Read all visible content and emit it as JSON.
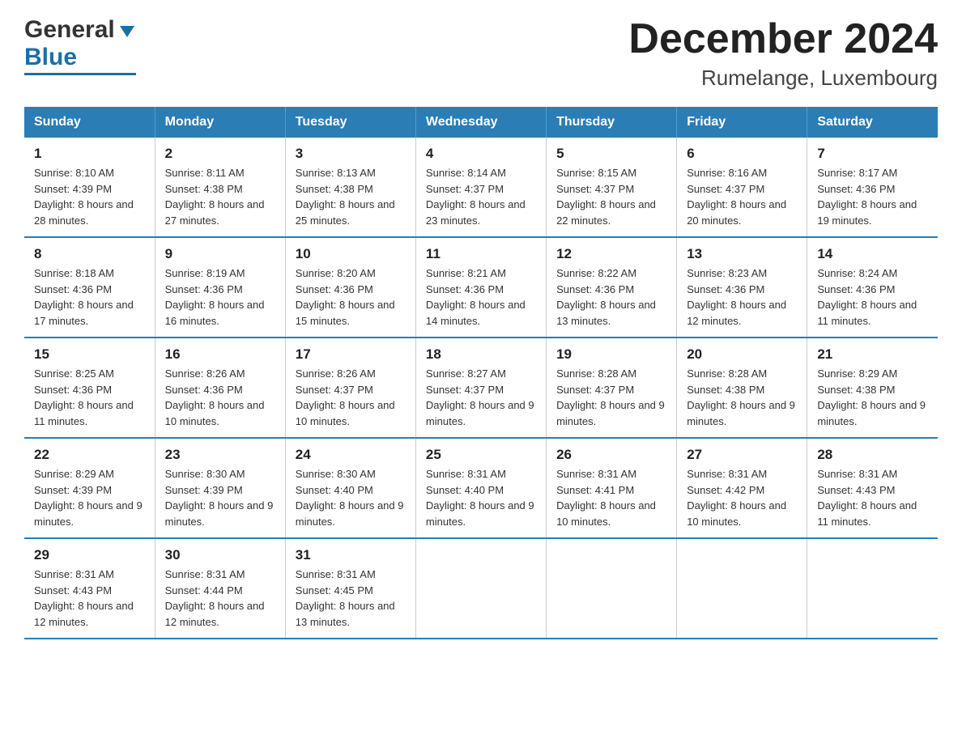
{
  "header": {
    "title": "December 2024",
    "subtitle": "Rumelange, Luxembourg",
    "logo_general": "General",
    "logo_blue": "Blue"
  },
  "weekdays": [
    "Sunday",
    "Monday",
    "Tuesday",
    "Wednesday",
    "Thursday",
    "Friday",
    "Saturday"
  ],
  "weeks": [
    [
      {
        "date": "1",
        "sunrise": "8:10 AM",
        "sunset": "4:39 PM",
        "daylight": "8 hours and 28 minutes."
      },
      {
        "date": "2",
        "sunrise": "8:11 AM",
        "sunset": "4:38 PM",
        "daylight": "8 hours and 27 minutes."
      },
      {
        "date": "3",
        "sunrise": "8:13 AM",
        "sunset": "4:38 PM",
        "daylight": "8 hours and 25 minutes."
      },
      {
        "date": "4",
        "sunrise": "8:14 AM",
        "sunset": "4:37 PM",
        "daylight": "8 hours and 23 minutes."
      },
      {
        "date": "5",
        "sunrise": "8:15 AM",
        "sunset": "4:37 PM",
        "daylight": "8 hours and 22 minutes."
      },
      {
        "date": "6",
        "sunrise": "8:16 AM",
        "sunset": "4:37 PM",
        "daylight": "8 hours and 20 minutes."
      },
      {
        "date": "7",
        "sunrise": "8:17 AM",
        "sunset": "4:36 PM",
        "daylight": "8 hours and 19 minutes."
      }
    ],
    [
      {
        "date": "8",
        "sunrise": "8:18 AM",
        "sunset": "4:36 PM",
        "daylight": "8 hours and 17 minutes."
      },
      {
        "date": "9",
        "sunrise": "8:19 AM",
        "sunset": "4:36 PM",
        "daylight": "8 hours and 16 minutes."
      },
      {
        "date": "10",
        "sunrise": "8:20 AM",
        "sunset": "4:36 PM",
        "daylight": "8 hours and 15 minutes."
      },
      {
        "date": "11",
        "sunrise": "8:21 AM",
        "sunset": "4:36 PM",
        "daylight": "8 hours and 14 minutes."
      },
      {
        "date": "12",
        "sunrise": "8:22 AM",
        "sunset": "4:36 PM",
        "daylight": "8 hours and 13 minutes."
      },
      {
        "date": "13",
        "sunrise": "8:23 AM",
        "sunset": "4:36 PM",
        "daylight": "8 hours and 12 minutes."
      },
      {
        "date": "14",
        "sunrise": "8:24 AM",
        "sunset": "4:36 PM",
        "daylight": "8 hours and 11 minutes."
      }
    ],
    [
      {
        "date": "15",
        "sunrise": "8:25 AM",
        "sunset": "4:36 PM",
        "daylight": "8 hours and 11 minutes."
      },
      {
        "date": "16",
        "sunrise": "8:26 AM",
        "sunset": "4:36 PM",
        "daylight": "8 hours and 10 minutes."
      },
      {
        "date": "17",
        "sunrise": "8:26 AM",
        "sunset": "4:37 PM",
        "daylight": "8 hours and 10 minutes."
      },
      {
        "date": "18",
        "sunrise": "8:27 AM",
        "sunset": "4:37 PM",
        "daylight": "8 hours and 9 minutes."
      },
      {
        "date": "19",
        "sunrise": "8:28 AM",
        "sunset": "4:37 PM",
        "daylight": "8 hours and 9 minutes."
      },
      {
        "date": "20",
        "sunrise": "8:28 AM",
        "sunset": "4:38 PM",
        "daylight": "8 hours and 9 minutes."
      },
      {
        "date": "21",
        "sunrise": "8:29 AM",
        "sunset": "4:38 PM",
        "daylight": "8 hours and 9 minutes."
      }
    ],
    [
      {
        "date": "22",
        "sunrise": "8:29 AM",
        "sunset": "4:39 PM",
        "daylight": "8 hours and 9 minutes."
      },
      {
        "date": "23",
        "sunrise": "8:30 AM",
        "sunset": "4:39 PM",
        "daylight": "8 hours and 9 minutes."
      },
      {
        "date": "24",
        "sunrise": "8:30 AM",
        "sunset": "4:40 PM",
        "daylight": "8 hours and 9 minutes."
      },
      {
        "date": "25",
        "sunrise": "8:31 AM",
        "sunset": "4:40 PM",
        "daylight": "8 hours and 9 minutes."
      },
      {
        "date": "26",
        "sunrise": "8:31 AM",
        "sunset": "4:41 PM",
        "daylight": "8 hours and 10 minutes."
      },
      {
        "date": "27",
        "sunrise": "8:31 AM",
        "sunset": "4:42 PM",
        "daylight": "8 hours and 10 minutes."
      },
      {
        "date": "28",
        "sunrise": "8:31 AM",
        "sunset": "4:43 PM",
        "daylight": "8 hours and 11 minutes."
      }
    ],
    [
      {
        "date": "29",
        "sunrise": "8:31 AM",
        "sunset": "4:43 PM",
        "daylight": "8 hours and 12 minutes."
      },
      {
        "date": "30",
        "sunrise": "8:31 AM",
        "sunset": "4:44 PM",
        "daylight": "8 hours and 12 minutes."
      },
      {
        "date": "31",
        "sunrise": "8:31 AM",
        "sunset": "4:45 PM",
        "daylight": "8 hours and 13 minutes."
      },
      {
        "date": "",
        "sunrise": "",
        "sunset": "",
        "daylight": ""
      },
      {
        "date": "",
        "sunrise": "",
        "sunset": "",
        "daylight": ""
      },
      {
        "date": "",
        "sunrise": "",
        "sunset": "",
        "daylight": ""
      },
      {
        "date": "",
        "sunrise": "",
        "sunset": "",
        "daylight": ""
      }
    ]
  ]
}
